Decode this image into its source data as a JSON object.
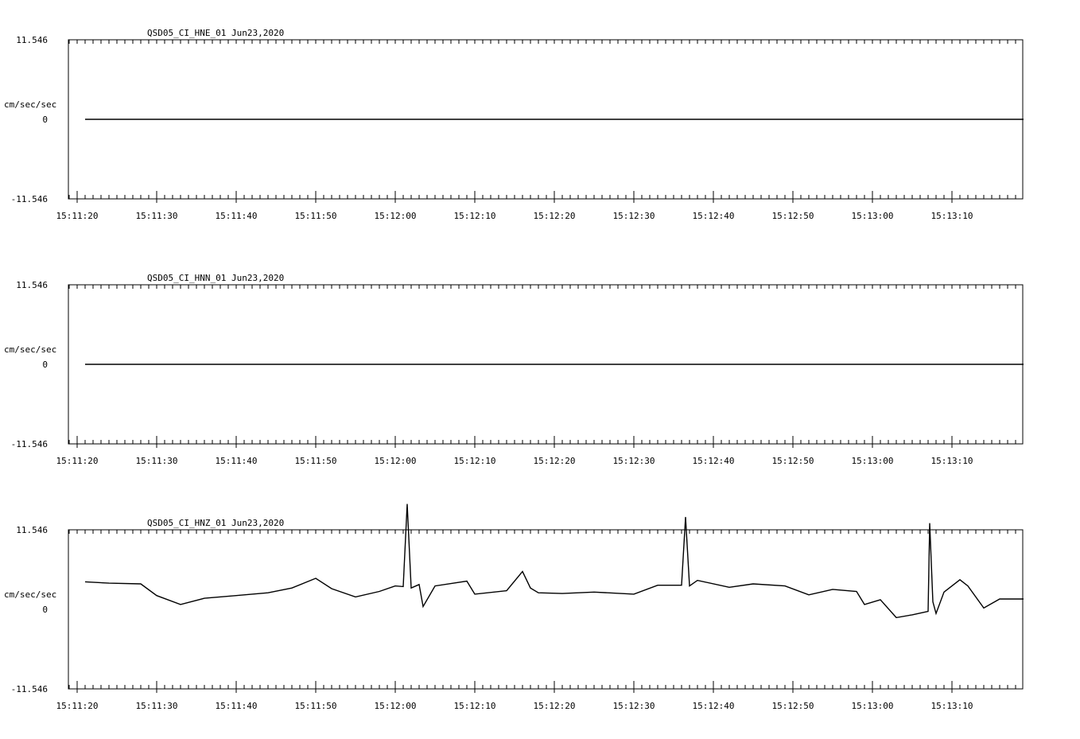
{
  "chart_data": [
    {
      "type": "line",
      "title": "QSD05_CI_HNE_01  Jun23,2020",
      "ylabel": "cm/sec/sec",
      "ylim": [
        -11.546,
        11.546
      ],
      "y_ticks": [
        "11.546",
        "0",
        "-11.546"
      ],
      "x_ticks": [
        "15:11:20",
        "15:11:30",
        "15:11:40",
        "15:11:50",
        "15:12:00",
        "15:12:10",
        "15:12:20",
        "15:12:30",
        "15:12:40",
        "15:12:50",
        "15:13:00",
        "15:13:10"
      ],
      "x_range_seconds": [
        "15:11:20",
        "15:13:19"
      ],
      "series": [
        {
          "x": [
            "15:11:21",
            "15:13:19"
          ],
          "values": [
            0,
            0
          ]
        }
      ]
    },
    {
      "type": "line",
      "title": "QSD05_CI_HNN_01  Jun23,2020",
      "ylabel": "cm/sec/sec",
      "ylim": [
        -11.546,
        11.546
      ],
      "y_ticks": [
        "11.546",
        "0",
        "-11.546"
      ],
      "x_ticks": [
        "15:11:20",
        "15:11:30",
        "15:11:40",
        "15:11:50",
        "15:12:00",
        "15:12:10",
        "15:12:20",
        "15:12:30",
        "15:12:40",
        "15:12:50",
        "15:13:00",
        "15:13:10"
      ],
      "series": [
        {
          "x": [
            "15:11:21",
            "15:13:19"
          ],
          "values": [
            0,
            0
          ]
        }
      ]
    },
    {
      "type": "line",
      "title": "QSD05_CI_HNZ_01  Jun23,2020",
      "ylabel": "cm/sec/sec",
      "ylim": [
        -11.546,
        11.546
      ],
      "y_ticks": [
        "11.546",
        "0",
        "-11.546"
      ],
      "x_ticks": [
        "15:11:20",
        "15:11:30",
        "15:11:40",
        "15:11:50",
        "15:12:00",
        "15:12:10",
        "15:12:20",
        "15:12:30",
        "15:12:40",
        "15:12:50",
        "15:13:00",
        "15:13:10"
      ],
      "series": [
        {
          "x": [
            "15:11:21",
            "15:11:24",
            "15:11:28",
            "15:11:30",
            "15:11:33",
            "15:11:36",
            "15:11:40",
            "15:11:44",
            "15:11:47",
            "15:11:50",
            "15:11:52",
            "15:11:55",
            "15:11:58",
            "15:12:00",
            "15:12:01",
            "15:12:01.5",
            "15:12:02",
            "15:12:03",
            "15:12:03.5",
            "15:12:05",
            "15:12:09",
            "15:12:10",
            "15:12:14",
            "15:12:16",
            "15:12:17",
            "15:12:18",
            "15:12:21",
            "15:12:25",
            "15:12:30",
            "15:12:33",
            "15:12:36",
            "15:12:36.5",
            "15:12:37",
            "15:12:38",
            "15:12:42",
            "15:12:45",
            "15:12:49",
            "15:12:52",
            "15:12:55",
            "15:12:58",
            "15:12:59",
            "15:13:01",
            "15:13:03",
            "15:13:05",
            "15:13:07",
            "15:13:07.2",
            "15:13:07.6",
            "15:13:08",
            "15:13:09",
            "15:13:11",
            "15:13:12",
            "15:13:14",
            "15:13:16",
            "15:13:19"
          ],
          "values": [
            4.0,
            3.8,
            3.7,
            2.0,
            0.7,
            1.6,
            2.0,
            2.4,
            3.1,
            4.5,
            3.0,
            1.8,
            2.6,
            3.4,
            3.3,
            15.3,
            3.1,
            3.6,
            0.4,
            3.4,
            4.1,
            2.2,
            2.7,
            5.5,
            3.1,
            2.4,
            2.3,
            2.5,
            2.2,
            3.5,
            3.5,
            13.4,
            3.4,
            4.2,
            3.2,
            3.7,
            3.4,
            2.1,
            2.9,
            2.6,
            0.7,
            1.4,
            -1.2,
            -0.8,
            -0.3,
            12.5,
            1.1,
            -0.6,
            2.5,
            4.3,
            3.4,
            0.2,
            1.5,
            1.5
          ]
        }
      ]
    }
  ]
}
